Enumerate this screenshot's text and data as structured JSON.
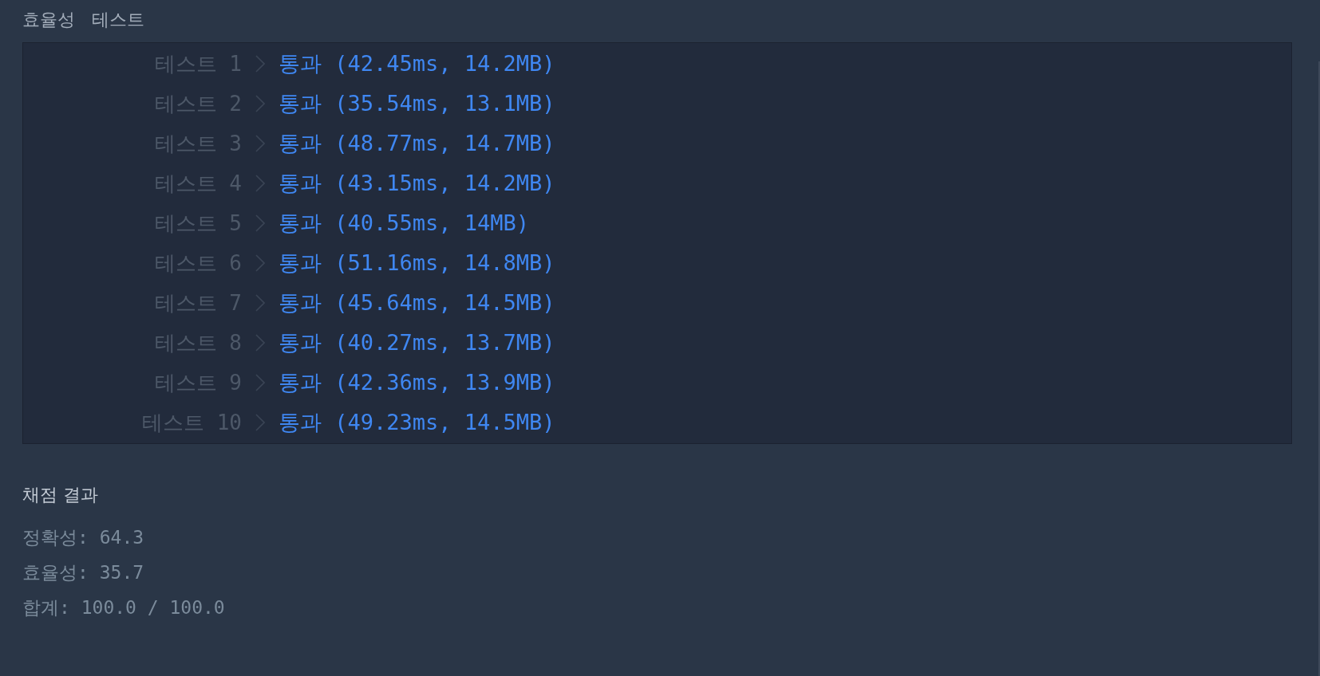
{
  "section_title": "효율성 테스트",
  "tests": [
    {
      "label": "테스트 1",
      "result": "통과 (42.45ms, 14.2MB)"
    },
    {
      "label": "테스트 2",
      "result": "통과 (35.54ms, 13.1MB)"
    },
    {
      "label": "테스트 3",
      "result": "통과 (48.77ms, 14.7MB)"
    },
    {
      "label": "테스트 4",
      "result": "통과 (43.15ms, 14.2MB)"
    },
    {
      "label": "테스트 5",
      "result": "통과 (40.55ms, 14MB)"
    },
    {
      "label": "테스트 6",
      "result": "통과 (51.16ms, 14.8MB)"
    },
    {
      "label": "테스트 7",
      "result": "통과 (45.64ms, 14.5MB)"
    },
    {
      "label": "테스트 8",
      "result": "통과 (40.27ms, 13.7MB)"
    },
    {
      "label": "테스트 9",
      "result": "통과 (42.36ms, 13.9MB)"
    },
    {
      "label": "테스트 10",
      "result": "통과 (49.23ms, 14.5MB)"
    }
  ],
  "grading": {
    "title": "채점 결과",
    "lines": [
      "정확성: 64.3",
      "효율성: 35.7",
      "합계: 100.0 / 100.0"
    ]
  }
}
